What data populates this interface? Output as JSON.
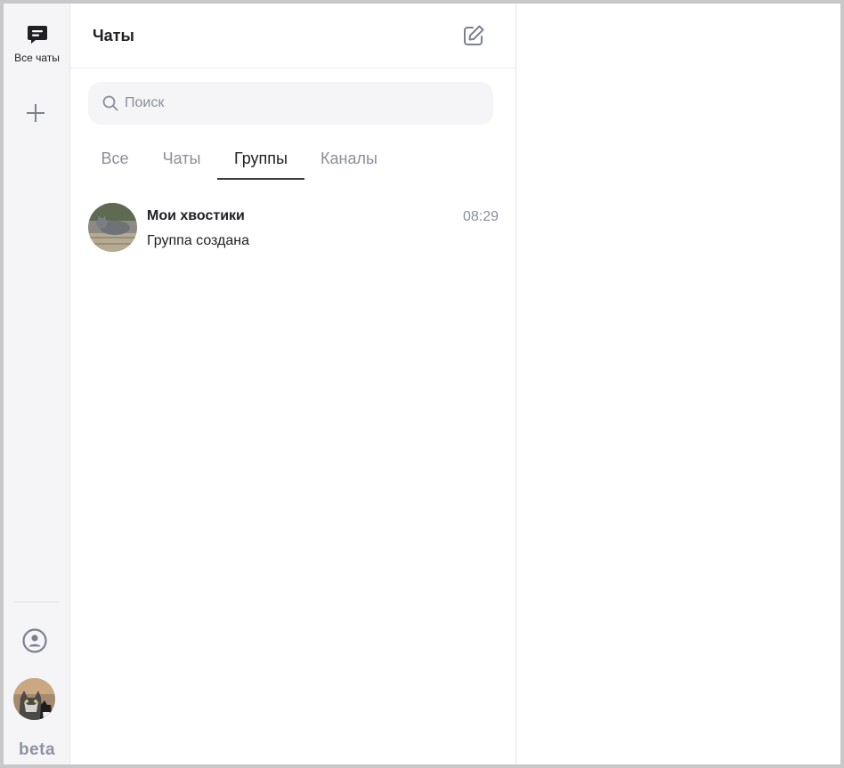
{
  "rail": {
    "all_chats_label": "Все чаты",
    "beta_label": "beta",
    "icons": {
      "all_chats": "chat-bubble-icon",
      "add": "plus-icon",
      "profile": "profile-icon",
      "avatar": "user-avatar"
    }
  },
  "panel": {
    "title": "Чаты",
    "compose_icon": "edit-icon",
    "search": {
      "placeholder": "Поиск",
      "value": ""
    },
    "tabs": [
      {
        "label": "Все",
        "active": false
      },
      {
        "label": "Чаты",
        "active": false
      },
      {
        "label": "Группы",
        "active": true
      },
      {
        "label": "Каналы",
        "active": false
      }
    ],
    "chats": [
      {
        "name": "Мои хвостики",
        "time": "08:29",
        "preview": "Группа создана",
        "avatar": "group-photo-cat"
      }
    ]
  },
  "colors": {
    "rail_bg": "#f5f5f7",
    "text": "#1f1f24",
    "muted": "#8a8e98",
    "accent_underline": "#3a3a44"
  }
}
